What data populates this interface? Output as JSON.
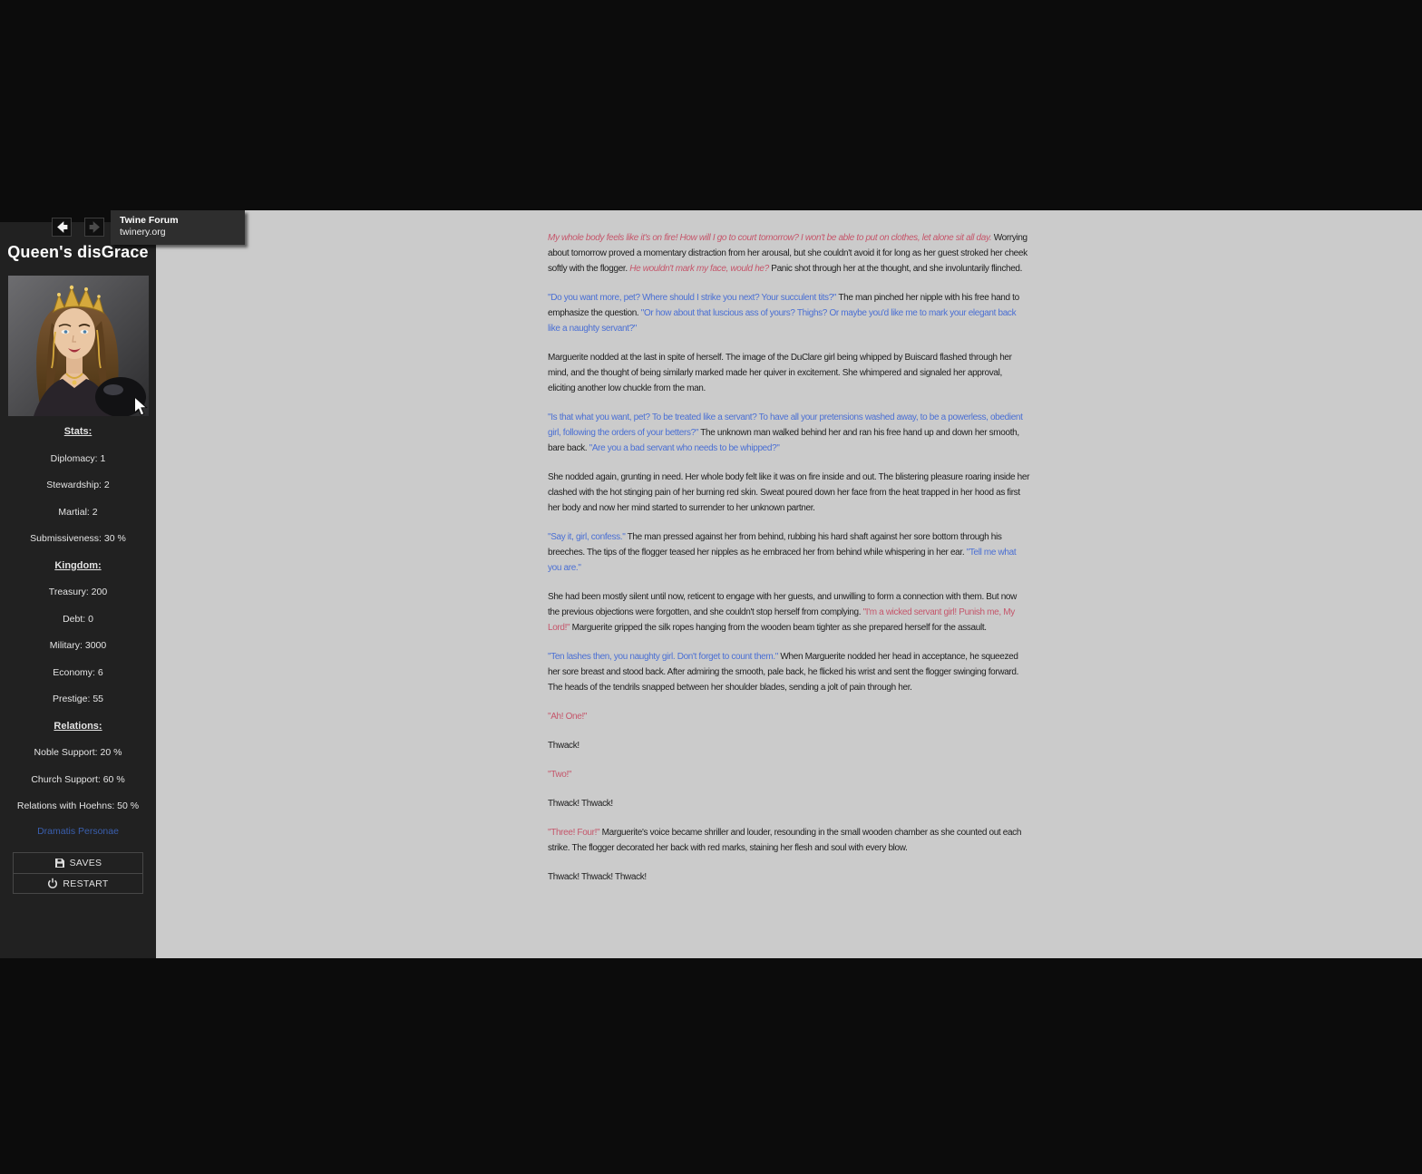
{
  "colors": {
    "page_bg": "#0c0c0c",
    "sidebar_bg": "#212121",
    "content_bg": "#cbcbcb",
    "story_text": "#1e1e1e",
    "speech_blue": "#4a6fd4",
    "speech_red": "#c5566b",
    "sidebar_text": "#e4e4e4",
    "link_blue": "#3a5fae",
    "tooltip_bg": "#2e2e2e"
  },
  "icons": {
    "back": "arrow-left-icon",
    "forward": "arrow-right-icon",
    "saves": "floppy-disk-icon",
    "restart": "power-icon"
  },
  "tooltip": {
    "title": "Twine Forum",
    "url": "twinery.org"
  },
  "sidebar": {
    "title": "Queen's disGrace",
    "groups": [
      {
        "heading": "Stats:",
        "items": [
          "Diplomacy: 1",
          "Stewardship: 2",
          "Martial: 2",
          "Submissiveness: 30 %"
        ]
      },
      {
        "heading": "Kingdom:",
        "items": [
          "Treasury: 200",
          "Debt: 0",
          "Military: 3000",
          "Economy: 6",
          "Prestige: 55"
        ]
      },
      {
        "heading": "Relations:",
        "items": [
          "Noble Support: 20 %",
          "Church Support: 60 %",
          "Relations with Hoehns: 50 %"
        ]
      }
    ],
    "menu_link": "Dramatis Personae",
    "saves_label": "SAVES",
    "restart_label": "RESTART"
  },
  "story": {
    "paragraphs": [
      {
        "segments": [
          {
            "style": "ri",
            "text": "My whole body feels like it's on fire! How will I go to court tomorrow? I won't be able to put on clothes, let alone sit all day."
          },
          {
            "style": "t",
            "text": " Worrying about tomorrow proved a momentary distraction from her arousal, but she couldn't avoid it for long as her guest stroked her cheek softly with the flogger. "
          },
          {
            "style": "ri",
            "text": "He wouldn't mark my face, would he?"
          },
          {
            "style": "t",
            "text": " Panic shot through her at the thought, and she involuntarily flinched."
          }
        ]
      },
      {
        "segments": [
          {
            "style": "b",
            "text": "\"Do you want more, pet? Where should I strike you next? Your succulent tits?\""
          },
          {
            "style": "t",
            "text": " The man pinched her nipple with his free hand to emphasize the question. "
          },
          {
            "style": "b",
            "text": "\"Or how about that luscious ass of yours? Thighs? Or maybe you'd like me to mark your elegant back like a naughty servant?\""
          }
        ]
      },
      {
        "segments": [
          {
            "style": "t",
            "text": "Marguerite nodded at the last in spite of herself. The image of the DuClare girl being whipped by Buiscard flashed through her mind, and the thought of being similarly marked made her quiver in excitement. She whimpered and signaled her approval, eliciting another low chuckle from the man."
          }
        ]
      },
      {
        "segments": [
          {
            "style": "b",
            "text": "\"Is that what you want, pet? To be treated like a servant? To have all your pretensions washed away, to be a powerless, obedient girl, following the orders of your betters?\""
          },
          {
            "style": "t",
            "text": " The unknown man walked behind her and ran his free hand up and down her smooth, bare back. "
          },
          {
            "style": "b",
            "text": "\"Are you a bad servant who needs to be whipped?\""
          }
        ]
      },
      {
        "segments": [
          {
            "style": "t",
            "text": "She nodded again, grunting in need. Her whole body felt like it was on fire inside and out. The blistering pleasure roaring inside her clashed with the hot stinging pain of her burning red skin. Sweat poured down her face from the heat trapped in her hood as first her body and now her mind started to surrender to her unknown partner."
          }
        ]
      },
      {
        "segments": [
          {
            "style": "b",
            "text": "\"Say it, girl, confess.\""
          },
          {
            "style": "t",
            "text": " The man pressed against her from behind, rubbing his hard shaft against her sore bottom through his breeches. The tips of the flogger teased her nipples as he embraced her from behind while whispering in her ear. "
          },
          {
            "style": "b",
            "text": "\"Tell me what you are.\""
          }
        ]
      },
      {
        "segments": [
          {
            "style": "t",
            "text": "She had been mostly silent until now, reticent to engage with her guests, and unwilling to form a connection with them. But now the previous objections were forgotten, and she couldn't stop herself from complying. "
          },
          {
            "style": "r",
            "text": "\"I'm a wicked servant girl! Punish me, My Lord!\""
          },
          {
            "style": "t",
            "text": " Marguerite gripped the silk ropes hanging from the wooden beam tighter as she prepared herself for the assault."
          }
        ]
      },
      {
        "segments": [
          {
            "style": "b",
            "text": "\"Ten lashes then, you naughty girl. Don't forget to count them.\""
          },
          {
            "style": "t",
            "text": " When Marguerite nodded her head in acceptance, he squeezed her sore breast and stood back. After admiring the smooth, pale back, he flicked his wrist and sent the flogger swinging forward. The heads of the tendrils snapped between her shoulder blades, sending a jolt of pain through her."
          }
        ]
      },
      {
        "segments": [
          {
            "style": "r",
            "text": "\"Ah! One!\""
          }
        ]
      },
      {
        "segments": [
          {
            "style": "t",
            "text": "Thwack!"
          }
        ]
      },
      {
        "segments": [
          {
            "style": "r",
            "text": "\"Two!\""
          }
        ]
      },
      {
        "segments": [
          {
            "style": "t",
            "text": "Thwack! Thwack!"
          }
        ]
      },
      {
        "segments": [
          {
            "style": "r",
            "text": "\"Three! Four!\""
          },
          {
            "style": "t",
            "text": " Marguerite's voice became shriller and louder, resounding in the small wooden chamber as she counted out each strike. The flogger decorated her back with red marks, staining her flesh and soul with every blow."
          }
        ]
      },
      {
        "segments": [
          {
            "style": "t",
            "text": "Thwack! Thwack! Thwack!"
          }
        ]
      }
    ]
  }
}
